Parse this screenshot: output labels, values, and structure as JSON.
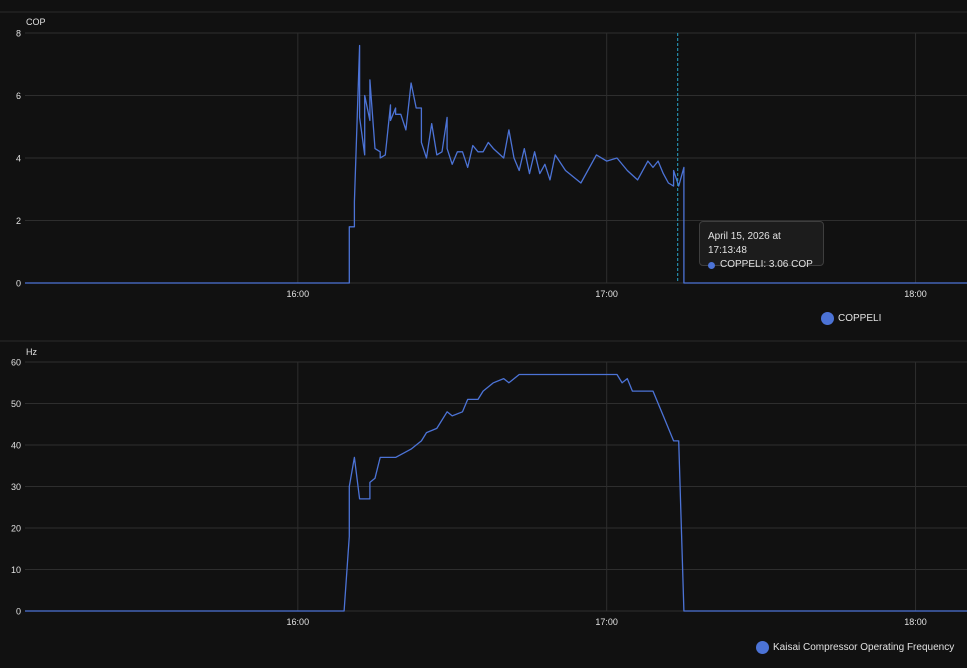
{
  "tooltip": {
    "date": "April 15, 2026 at 17:13:48",
    "series_value": "COPPELI: 3.06 COP"
  },
  "colors": {
    "series": "#4c73d6",
    "background": "#111111",
    "grid": "#2e2e2e",
    "text": "#e1e1e1"
  },
  "chart_data": [
    {
      "type": "line",
      "ylabel": "COP",
      "ylim": [
        0,
        8
      ],
      "yticks": [
        "0",
        "2",
        "4",
        "6",
        "8"
      ],
      "xlim": [
        "15:07",
        "18:10"
      ],
      "xticks": [
        "16:00",
        "17:00",
        "18:00"
      ],
      "grid": true,
      "legend_position": "bottom-right",
      "cursor_time": "17:13:48",
      "series": [
        {
          "name": "COPPELI",
          "x": [
            "15:07",
            "16:10",
            "16:10",
            "16:11",
            "16:11",
            "16:12",
            "16:12",
            "16:12",
            "16:13",
            "16:13",
            "16:14",
            "16:14",
            "16:15",
            "16:16",
            "16:16",
            "16:17",
            "16:18",
            "16:18",
            "16:19",
            "16:19",
            "16:20",
            "16:21",
            "16:22",
            "16:23",
            "16:24",
            "16:24",
            "16:25",
            "16:26",
            "16:27",
            "16:28",
            "16:29",
            "16:29",
            "16:30",
            "16:31",
            "16:32",
            "16:33",
            "16:34",
            "16:35",
            "16:36",
            "16:37",
            "16:38",
            "16:40",
            "16:41",
            "16:42",
            "16:43",
            "16:44",
            "16:45",
            "16:46",
            "16:47",
            "16:48",
            "16:49",
            "16:50",
            "16:52",
            "16:55",
            "16:58",
            "17:00",
            "17:02",
            "17:04",
            "17:06",
            "17:08",
            "17:09",
            "17:10",
            "17:11",
            "17:12",
            "17:13",
            "17:13",
            "17:14",
            "17:15",
            "17:15",
            "18:10"
          ],
          "y": [
            0,
            0,
            1.8,
            1.8,
            2.6,
            7.6,
            7.6,
            5.3,
            4.1,
            6.0,
            5.2,
            6.5,
            4.3,
            4.2,
            4.0,
            4.1,
            5.7,
            5.2,
            5.6,
            5.4,
            5.4,
            4.9,
            6.4,
            5.6,
            5.6,
            4.5,
            4.0,
            5.1,
            4.1,
            4.2,
            5.3,
            4.3,
            3.8,
            4.2,
            4.2,
            3.7,
            4.4,
            4.2,
            4.2,
            4.5,
            4.3,
            4.0,
            4.9,
            4.0,
            3.6,
            4.3,
            3.5,
            4.2,
            3.5,
            3.8,
            3.3,
            4.1,
            3.6,
            3.2,
            4.1,
            3.9,
            4.0,
            3.6,
            3.3,
            3.9,
            3.7,
            3.9,
            3.5,
            3.2,
            3.1,
            3.6,
            3.1,
            3.7,
            0,
            0
          ]
        }
      ]
    },
    {
      "type": "line",
      "ylabel": "Hz",
      "ylim": [
        0,
        60
      ],
      "yticks": [
        "0",
        "10",
        "20",
        "30",
        "40",
        "50",
        "60"
      ],
      "xlim": [
        "15:07",
        "18:10"
      ],
      "xticks": [
        "16:00",
        "17:00",
        "18:00"
      ],
      "grid": true,
      "legend_position": "bottom-right",
      "series": [
        {
          "name": "Kaisai Compressor Operating Frequency",
          "x": [
            "15:07",
            "16:09",
            "16:10",
            "16:10",
            "16:11",
            "16:11",
            "16:12",
            "16:14",
            "16:14",
            "16:15",
            "16:16",
            "16:19",
            "16:22",
            "16:23",
            "16:24",
            "16:25",
            "16:27",
            "16:29",
            "16:30",
            "16:32",
            "16:33",
            "16:35",
            "16:36",
            "16:38",
            "16:40",
            "16:41",
            "16:43",
            "16:45",
            "16:47",
            "16:48",
            "16:50",
            "16:52",
            "16:55",
            "17:00",
            "17:02",
            "17:03",
            "17:04",
            "17:05",
            "17:09",
            "17:11",
            "17:13",
            "17:14",
            "17:15",
            "18:10"
          ],
          "y": [
            0,
            0,
            18,
            30,
            37,
            37,
            27,
            27,
            31,
            32,
            37,
            37,
            39,
            40,
            41,
            43,
            44,
            48,
            47,
            48,
            51,
            51,
            53,
            55,
            56,
            55,
            57,
            57,
            57,
            57,
            57,
            57,
            57,
            57,
            57,
            55,
            56,
            53,
            53,
            47,
            41,
            41,
            0,
            0
          ]
        }
      ]
    }
  ]
}
